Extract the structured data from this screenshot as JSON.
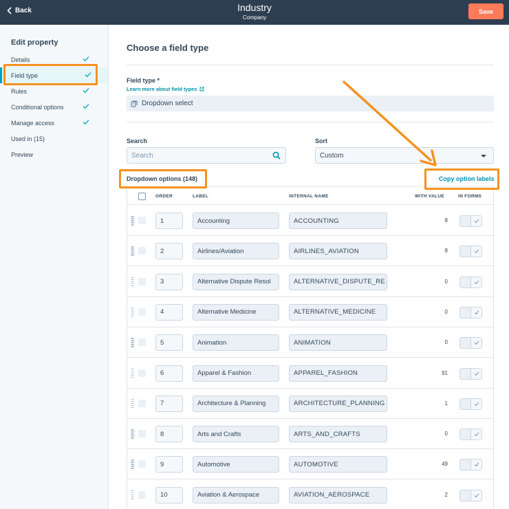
{
  "header": {
    "back_label": "Back",
    "title": "Industry",
    "subtitle": "Company",
    "save_label": "Save"
  },
  "sidebar": {
    "heading": "Edit property",
    "items": [
      {
        "label": "Details",
        "checked": true
      },
      {
        "label": "Field type",
        "checked": true,
        "active": true
      },
      {
        "label": "Rules",
        "checked": true
      },
      {
        "label": "Conditional options",
        "checked": true
      },
      {
        "label": "Manage access",
        "checked": true
      },
      {
        "label": "Used in (15)",
        "checked": false
      },
      {
        "label": "Preview",
        "checked": false
      }
    ]
  },
  "main": {
    "title": "Choose a field type",
    "field_type_label": "Field type *",
    "learn_more_link": "Learn more about field types",
    "field_type_value": "Dropdown select",
    "search_label": "Search",
    "search_placeholder": "Search",
    "sort_label": "Sort",
    "sort_value": "Custom",
    "options_count": "Dropdown options (148)",
    "copy_labels": "Copy option labels"
  },
  "table": {
    "columns": {
      "order": "ORDER",
      "label": "LABEL",
      "internal_name": "INTERNAL NAME",
      "with_value": "WITH VALUE",
      "in_forms": "IN FORMS"
    },
    "rows": [
      {
        "order": "1",
        "label": "Accounting",
        "internal_name": "ACCOUNTING",
        "with_value": "8"
      },
      {
        "order": "2",
        "label": "Airlines/Aviation",
        "internal_name": "AIRLINES_AVIATION",
        "with_value": "8"
      },
      {
        "order": "3",
        "label": "Alternative Dispute Resol",
        "internal_name": "ALTERNATIVE_DISPUTE_RE",
        "with_value": "0"
      },
      {
        "order": "4",
        "label": "Alternative Medicine",
        "internal_name": "ALTERNATIVE_MEDICINE",
        "with_value": "0"
      },
      {
        "order": "5",
        "label": "Animation",
        "internal_name": "ANIMATION",
        "with_value": "0"
      },
      {
        "order": "6",
        "label": "Apparel & Fashion",
        "internal_name": "APPAREL_FASHION",
        "with_value": "91"
      },
      {
        "order": "7",
        "label": "Architecture & Planning",
        "internal_name": "ARCHITECTURE_PLANNING",
        "with_value": "1"
      },
      {
        "order": "8",
        "label": "Arts and Crafts",
        "internal_name": "ARTS_AND_CRAFTS",
        "with_value": "0"
      },
      {
        "order": "9",
        "label": "Automotive",
        "internal_name": "AUTOMOTIVE",
        "with_value": "49"
      },
      {
        "order": "10",
        "label": "Aviation & Aerospace",
        "internal_name": "AVIATION_AEROSPACE",
        "with_value": "2"
      }
    ]
  },
  "colors": {
    "header_bg": "#2d3e50",
    "accent_orange": "#ff7a59",
    "link_teal": "#0091ae",
    "highlight_orange": "#f5911f"
  },
  "icons": [
    "chevron-left-icon",
    "check-icon",
    "external-link-icon",
    "dropdown-field-icon",
    "search-icon",
    "caret-down-icon",
    "drag-handle-icon"
  ]
}
